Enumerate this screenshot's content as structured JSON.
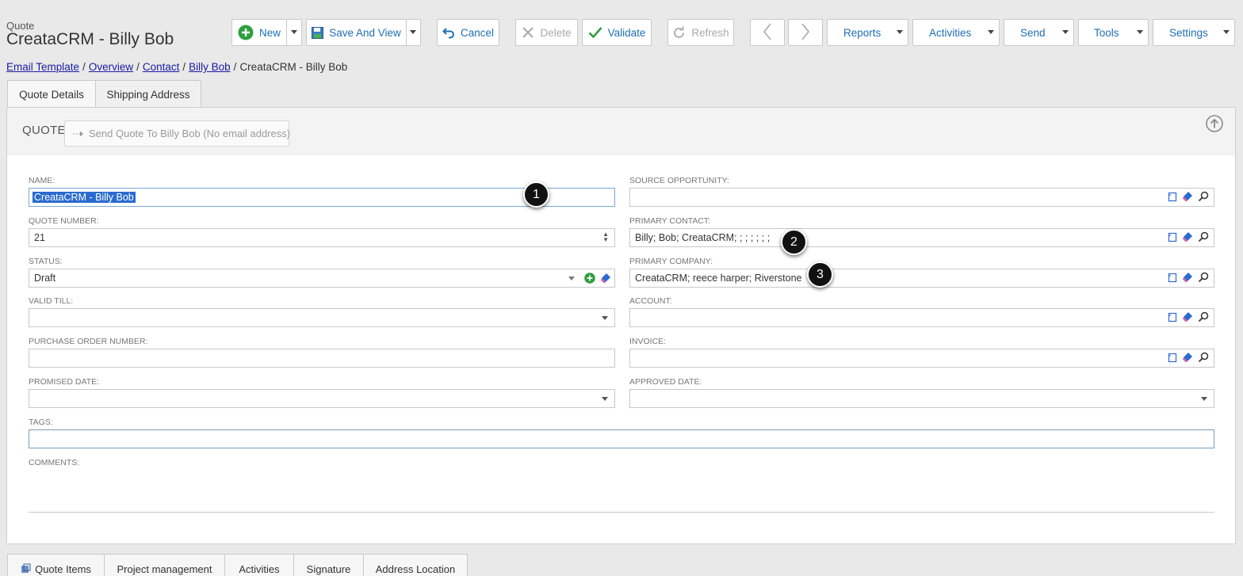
{
  "header": {
    "entity_type": "Quote",
    "title": "CreataCRM - Billy Bob"
  },
  "toolbar": {
    "new": "New",
    "save_and_view": "Save And View",
    "cancel": "Cancel",
    "delete": "Delete",
    "validate": "Validate",
    "refresh": "Refresh",
    "reports": "Reports",
    "activities": "Activities",
    "send": "Send",
    "tools": "Tools",
    "settings": "Settings"
  },
  "breadcrumb": {
    "items": [
      "Email Template",
      "Overview",
      "Contact",
      "Billy Bob"
    ],
    "current": "CreataCRM - Billy Bob",
    "separator": "/"
  },
  "tabs": [
    "Quote Details",
    "Shipping Address"
  ],
  "section": {
    "title": "QUOTE",
    "send_button": "Send Quote To Billy Bob (No email address)"
  },
  "fields": {
    "name": {
      "label": "NAME:",
      "value": "CreataCRM - Billy Bob"
    },
    "quote_number": {
      "label": "QUOTE NUMBER:",
      "value": "21"
    },
    "status": {
      "label": "STATUS:",
      "value": "Draft"
    },
    "valid_till": {
      "label": "VALID TILL:",
      "value": ""
    },
    "purchase_order_number": {
      "label": "PURCHASE ORDER NUMBER:",
      "value": ""
    },
    "promised_date": {
      "label": "PROMISED DATE:",
      "value": ""
    },
    "tags": {
      "label": "TAGS:",
      "value": ""
    },
    "comments": {
      "label": "COMMENTS:",
      "value": ""
    },
    "source_opportunity": {
      "label": "SOURCE OPPORTUNITY:",
      "value": ""
    },
    "primary_contact": {
      "label": "PRIMARY CONTACT:",
      "value": "Billy; Bob; CreataCRM; ; ; ; ; ; ;"
    },
    "primary_company": {
      "label": "PRIMARY COMPANY:",
      "value": "CreataCRM; reece harper; Riverstone"
    },
    "account": {
      "label": "ACCOUNT:",
      "value": ""
    },
    "invoice": {
      "label": "INVOICE:",
      "value": ""
    },
    "approved_date": {
      "label": "APPROVED DATE:",
      "value": ""
    }
  },
  "callouts": [
    "1",
    "2",
    "3"
  ],
  "bottom_tabs": [
    "Quote Items",
    "Project management",
    "Activities",
    "Signature",
    "Address Location"
  ],
  "colors": {
    "link": "#1e6fb5",
    "selection": "#2a6bcf",
    "add_green": "#2e9e3e",
    "callout": "#111111"
  }
}
